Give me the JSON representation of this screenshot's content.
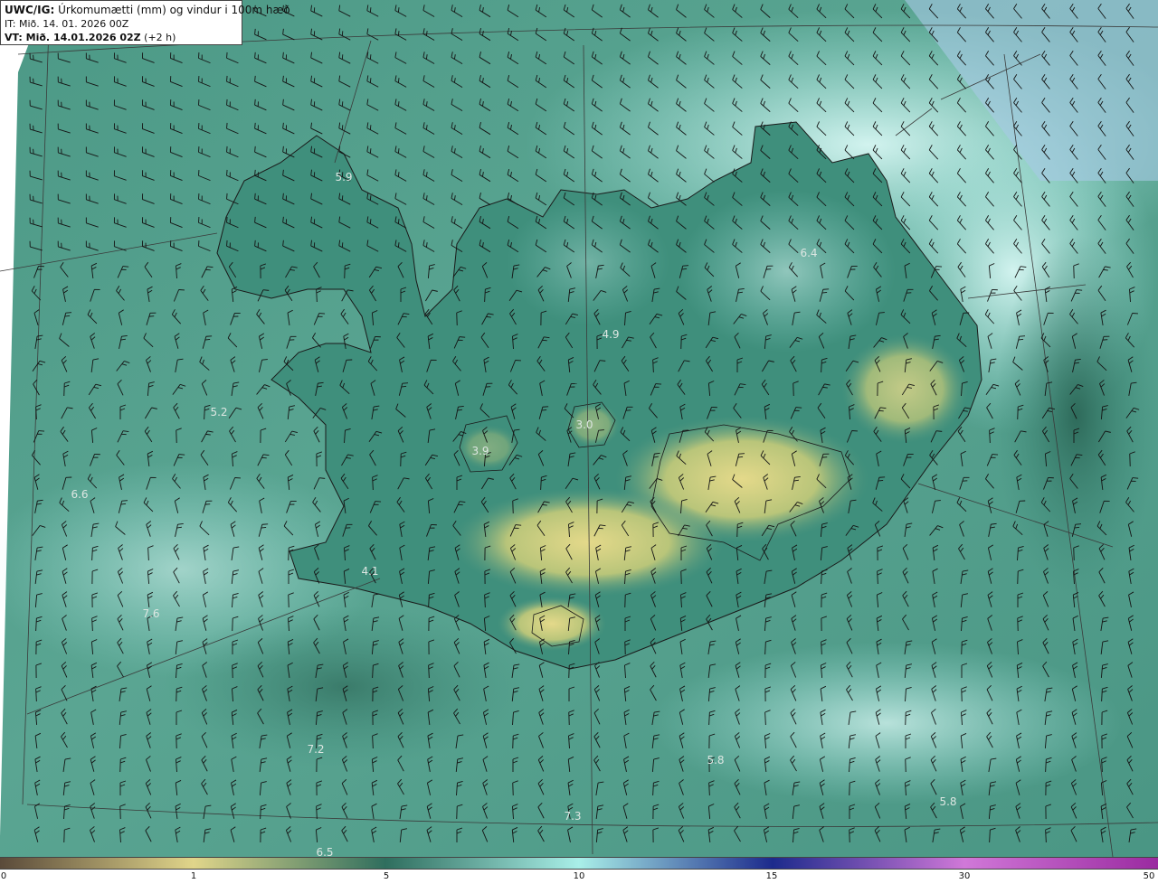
{
  "header": {
    "product_code": "UWC/IG:",
    "product_title": " Úrkomumætti (mm) og vindur i 100m hæð",
    "it_line": "IT: Mið. 14. 01. 2026 00Z",
    "vt_prefix": "VT:",
    "vt_value": " Mið. 14.01.2026 02Z",
    "vt_suffix": " (+2 h)"
  },
  "value_labels": [
    "5.9",
    "6.4",
    "4.9",
    "5.2",
    "3.0",
    "3.9",
    "6.6",
    "4.1",
    "7.6",
    "7.2",
    "5.8",
    "5.8",
    "7.3",
    "6.5"
  ],
  "colorbar": {
    "ticks": [
      "0",
      "1",
      "5",
      "10",
      "15",
      "30",
      "50"
    ],
    "colors": {
      "c0": "#5a4a3a",
      "c1": "#e0d58a",
      "c2": "#2f6e5e",
      "c3": "#a9efe8",
      "c4": "#1c2a8c",
      "c5": "#d078d8",
      "c6": "#9a2aa0"
    }
  },
  "colors": {
    "sea": "#3d8a78",
    "land_high": "#d6cf7f",
    "coast": "#1a1a1a",
    "barb": "#141414",
    "grid": "#3a3a3a"
  }
}
